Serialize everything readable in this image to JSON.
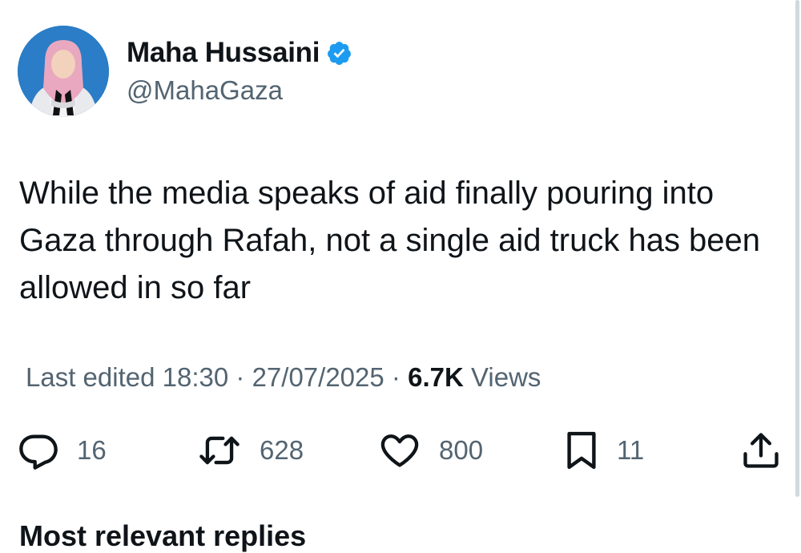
{
  "author": {
    "display_name": "Maha Hussaini",
    "handle": "@MahaGaza",
    "verified": true,
    "verified_color": "#1d9bf0"
  },
  "tweet": {
    "text": "While the media speaks of aid finally pouring into Gaza through Rafah, not a single aid truck has been allowed in so far"
  },
  "meta": {
    "edited_label": "Last edited",
    "time": "18:30",
    "separator": "·",
    "date": "27/07/2025",
    "views_count": "6.7K",
    "views_label": "Views"
  },
  "actions": {
    "replies": "16",
    "reposts": "628",
    "likes": "800",
    "bookmarks": "11"
  },
  "icons": {
    "reply": "reply-icon",
    "repost": "repost-icon",
    "like": "heart-icon",
    "bookmark": "bookmark-icon",
    "share": "share-icon",
    "verified": "verified-badge-icon"
  },
  "section": {
    "replies_heading": "Most relevant replies"
  },
  "colors": {
    "text_primary": "#0f1419",
    "text_secondary": "#536471",
    "accent": "#1d9bf0"
  }
}
